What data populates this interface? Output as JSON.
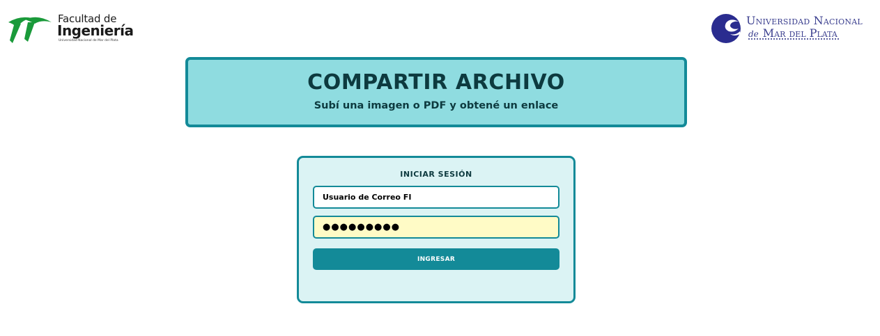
{
  "logos": {
    "faculty": {
      "line1": "Facultad de",
      "line2": "Ingeniería",
      "line3": "Universidad Nacional de Mar del Plata",
      "color": "#1a9a3a"
    },
    "university": {
      "line1": "Universidad Nacional",
      "line2_de": "de",
      "line2_name": "Mar del Plata",
      "color": "#2a2c8f"
    }
  },
  "banner": {
    "title": "COMPARTIR ARCHIVO",
    "subtitle": "Subí una imagen o PDF y obtené un enlace"
  },
  "login": {
    "title": "INICIAR SESIÓN",
    "username_value": "Usuario de Correo FI",
    "password_value": "●●●●●●●●●",
    "submit_label": "INGRESAR"
  },
  "colors": {
    "accent": "#138a98",
    "banner_bg": "#8fdce0",
    "card_bg": "#dbf3f4",
    "password_bg": "#fffbc6",
    "text_dark": "#0d3a3f"
  }
}
